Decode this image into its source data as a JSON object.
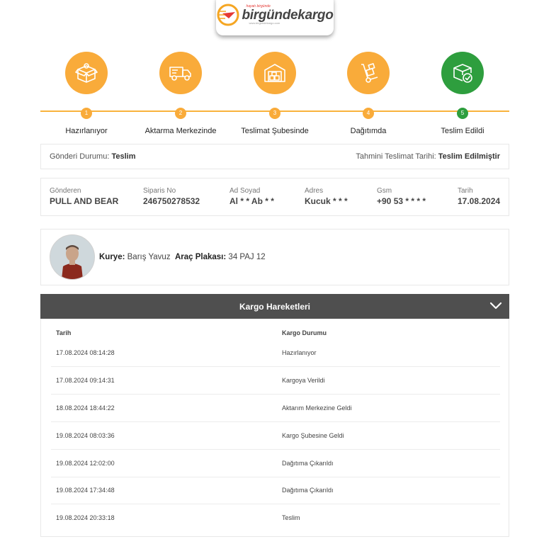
{
  "brand": {
    "name": "birgündekargo",
    "tagline": "hayatı birgünde",
    "site": "www.birgundekargo.com"
  },
  "steps": [
    {
      "number": "1",
      "label": "Hazırlanıyor",
      "icon": "box-icon",
      "status": "active"
    },
    {
      "number": "2",
      "label": "Aktarma Merkezinde",
      "icon": "truck-icon",
      "status": "active"
    },
    {
      "number": "3",
      "label": "Teslimat Şubesinde",
      "icon": "warehouse-icon",
      "status": "active"
    },
    {
      "number": "4",
      "label": "Dağıtımda",
      "icon": "hand-truck-icon",
      "status": "active"
    },
    {
      "number": "5",
      "label": "Teslim Edildi",
      "icon": "delivered-box-icon",
      "status": "done"
    }
  ],
  "status": {
    "label": "Gönderi Durumu:",
    "value": "Teslim",
    "eta_label": "Tahmini Teslimat Tarihi:",
    "eta_value": "Teslim Edilmiştir"
  },
  "info": [
    {
      "key": "Gönderen",
      "value": "PULL AND BEAR"
    },
    {
      "key": "Siparis No",
      "value": "246750278532"
    },
    {
      "key": "Ad Soyad",
      "value": "Al * * Ab * *"
    },
    {
      "key": "Adres",
      "value": "Kucuk * * *"
    },
    {
      "key": "Gsm",
      "value": "+90 53 * * * *"
    },
    {
      "key": "Tarih",
      "value": "17.08.2024"
    }
  ],
  "courier": {
    "label": "Kurye:",
    "name": "Barış Yavuz",
    "plate_label": "Araç Plakası:",
    "plate": "34 PAJ 12"
  },
  "movements": {
    "title": "Kargo Hareketleri",
    "col_date": "Tarih",
    "col_status": "Kargo Durumu",
    "rows": [
      {
        "date": "17.08.2024 08:14:28",
        "status": "Hazırlanıyor"
      },
      {
        "date": "17.08.2024 09:14:31",
        "status": "Kargoya Verildi"
      },
      {
        "date": "18.08.2024 18:44:22",
        "status": "Aktarım Merkezine Geldi"
      },
      {
        "date": "19.08.2024 08:03:36",
        "status": "Kargo Şubesine Geldi"
      },
      {
        "date": "19.08.2024 12:02:00",
        "status": "Dağıtıma Çıkarıldı"
      },
      {
        "date": "19.08.2024 17:34:48",
        "status": "Dağıtıma Çıkarıldı"
      },
      {
        "date": "19.08.2024 20:33:18",
        "status": "Teslim"
      }
    ]
  },
  "colors": {
    "accent": "#f9ab3a",
    "done": "#2e9e3e",
    "header_bg": "#4f4f4f"
  }
}
